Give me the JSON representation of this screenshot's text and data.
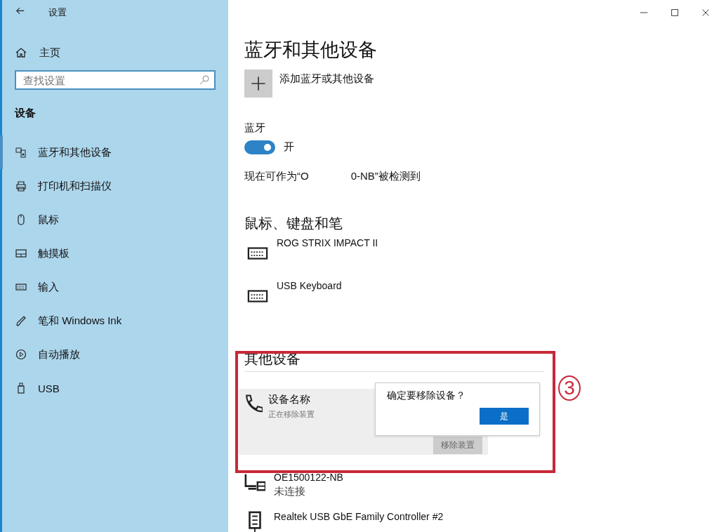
{
  "window": {
    "title": "设置"
  },
  "sidebar": {
    "home": "主页",
    "search": {
      "placeholder": "查找设置"
    },
    "section": "设备",
    "items": [
      {
        "label": "蓝牙和其他设备",
        "kind": "bluetooth",
        "selected": true
      },
      {
        "label": "打印机和扫描仪",
        "kind": "printer",
        "selected": false
      },
      {
        "label": "鼠标",
        "kind": "mouse",
        "selected": false
      },
      {
        "label": "触摸板",
        "kind": "touchpad",
        "selected": false
      },
      {
        "label": "输入",
        "kind": "keyboard",
        "selected": false
      },
      {
        "label": "笔和 Windows Ink",
        "kind": "pen",
        "selected": false
      },
      {
        "label": "自动播放",
        "kind": "autoplay",
        "selected": false
      },
      {
        "label": "USB",
        "kind": "usb",
        "selected": false
      }
    ]
  },
  "main": {
    "title": "蓝牙和其他设备",
    "add_device": "添加蓝牙或其他设备",
    "bluetooth": {
      "label": "蓝牙",
      "on": true,
      "state_text": "开",
      "discoverable": [
        "现在可作为“O",
        "0-NB”被检测到"
      ]
    },
    "input_devices": {
      "heading": "鼠标、键盘和笔",
      "devices": [
        {
          "name": "ROG STRIX IMPACT II",
          "kind": "keyboard"
        },
        {
          "name": "USB Keyboard",
          "kind": "keyboard"
        }
      ]
    },
    "other_devices": {
      "heading": "其他设备",
      "selected_device": {
        "name": "设备名称",
        "status": "正在移除装置",
        "kind": "phone",
        "remove_button": {
          "label": "移除装置",
          "disabled": true
        }
      },
      "confirm": {
        "question": "确定要移除设备？",
        "yes": "是"
      },
      "devices": [
        {
          "name": "OE1500122-NB",
          "status": "未连接",
          "kind": "computer"
        },
        {
          "name": "Realtek USB GbE Family Controller #2",
          "kind": "network"
        }
      ]
    }
  },
  "annotation": {
    "number": "3"
  }
}
